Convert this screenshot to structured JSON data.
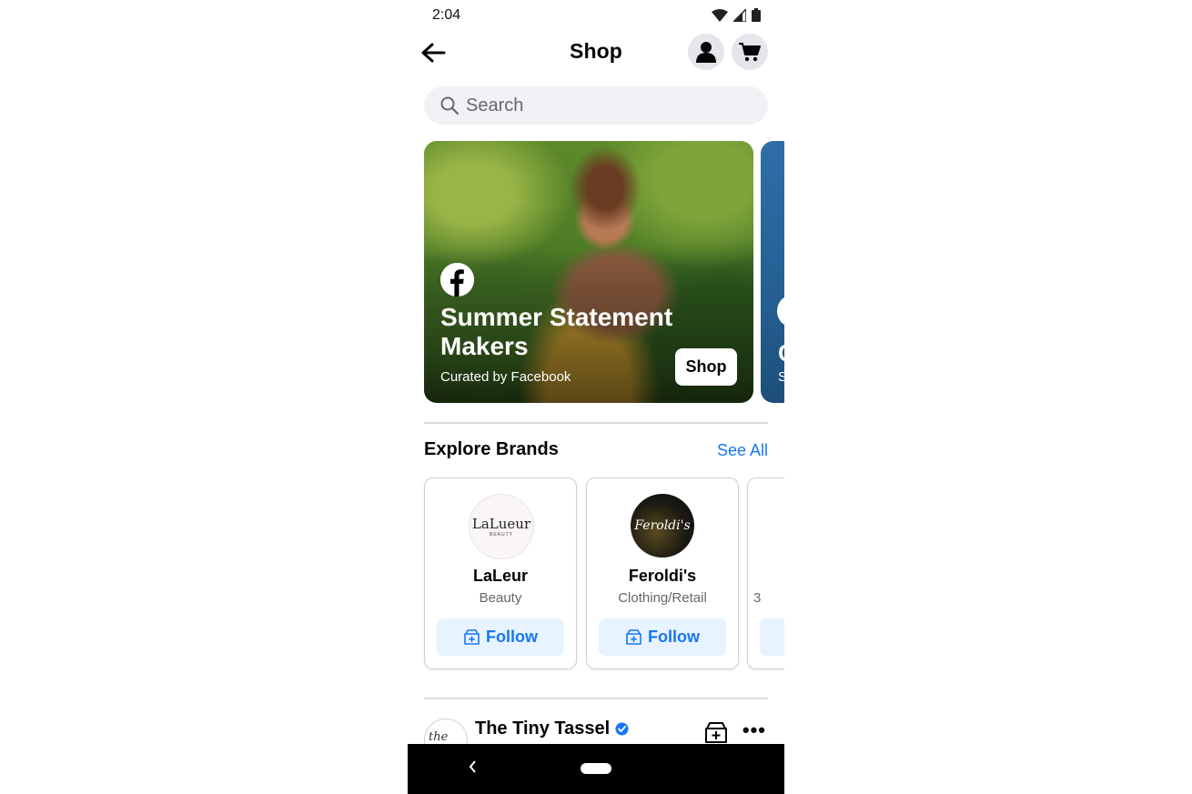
{
  "status_bar": {
    "time": "2:04"
  },
  "header": {
    "title": "Shop"
  },
  "search": {
    "placeholder": "Search"
  },
  "hero": {
    "title": "Summer Statement Makers",
    "subtitle": "Curated by Facebook",
    "button": "Shop",
    "next_card_title_partial": "C",
    "next_card_subtitle_partial": "S"
  },
  "brands": {
    "title": "Explore Brands",
    "see_all": "See All",
    "items": [
      {
        "name": "LaLeur",
        "category": "Beauty",
        "logo_text": "LaLueur",
        "logo_sub": "BEAUTY",
        "follow": "Follow"
      },
      {
        "name": "Feroldi's",
        "category": "Clothing/Retail",
        "logo_text": "Feroldi's",
        "follow": "Follow"
      },
      {
        "name": "",
        "category": "3",
        "follow": ""
      }
    ]
  },
  "post": {
    "shop_name": "The Tiny Tassel",
    "avatar_text": "the tiny"
  },
  "colors": {
    "accent": "#1877f2",
    "follow_bg": "#e7f3ff",
    "search_bg": "#f0f2f5"
  },
  "icons": [
    "back-arrow-icon",
    "profile-icon",
    "cart-icon",
    "search-icon",
    "facebook-logo-icon",
    "shop-follow-icon",
    "verified-icon",
    "more-icon",
    "nav-back-icon"
  ]
}
